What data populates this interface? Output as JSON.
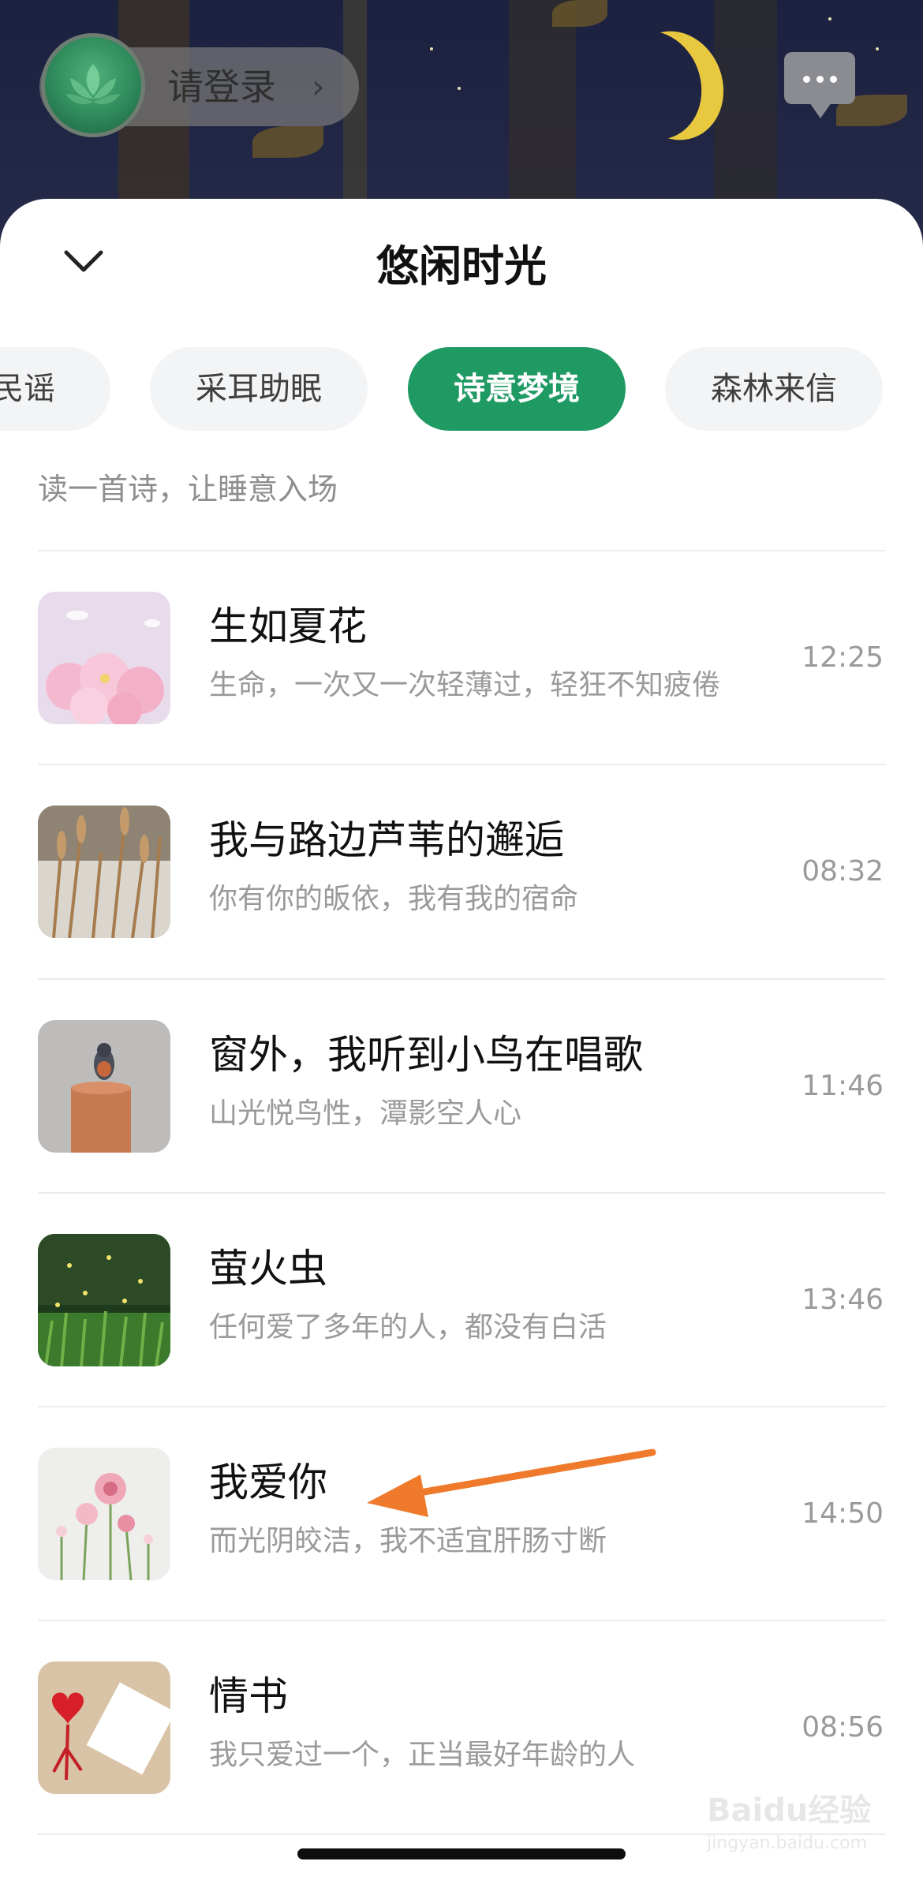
{
  "header": {
    "login_label": "请登录",
    "chevron": "›",
    "message_icon": "chat-bubble-icon"
  },
  "sheet": {
    "title": "悠闲时光",
    "collapse_icon": "chevron-down-icon"
  },
  "tabs": [
    {
      "label": "民谣",
      "active": false
    },
    {
      "label": "采耳助眠",
      "active": false
    },
    {
      "label": "诗意梦境",
      "active": true
    },
    {
      "label": "森林来信",
      "active": false
    }
  ],
  "subtitle": "读一首诗，让睡意入场",
  "items": [
    {
      "title": "生如夏花",
      "desc": "生命，一次又一次轻薄过，轻狂不知疲倦",
      "time": "12:25"
    },
    {
      "title": "我与路边芦苇的邂逅",
      "desc": "你有你的皈依，我有我的宿命",
      "time": "08:32"
    },
    {
      "title": "窗外，我听到小鸟在唱歌",
      "desc": "山光悦鸟性，潭影空人心",
      "time": "11:46"
    },
    {
      "title": "萤火虫",
      "desc": "任何爱了多年的人，都没有白活",
      "time": "13:46"
    },
    {
      "title": "我爱你",
      "desc": "而光阴皎洁，我不适宜肝肠寸断",
      "time": "14:50"
    },
    {
      "title": "情书",
      "desc": "我只爱过一个，正当最好年龄的人",
      "time": "08:56"
    }
  ],
  "colors": {
    "accent": "#1f9a63",
    "annotation_arrow": "#f07a2c"
  },
  "watermark": {
    "main": "Baidu经验",
    "sub": "jingyan.baidu.com"
  }
}
